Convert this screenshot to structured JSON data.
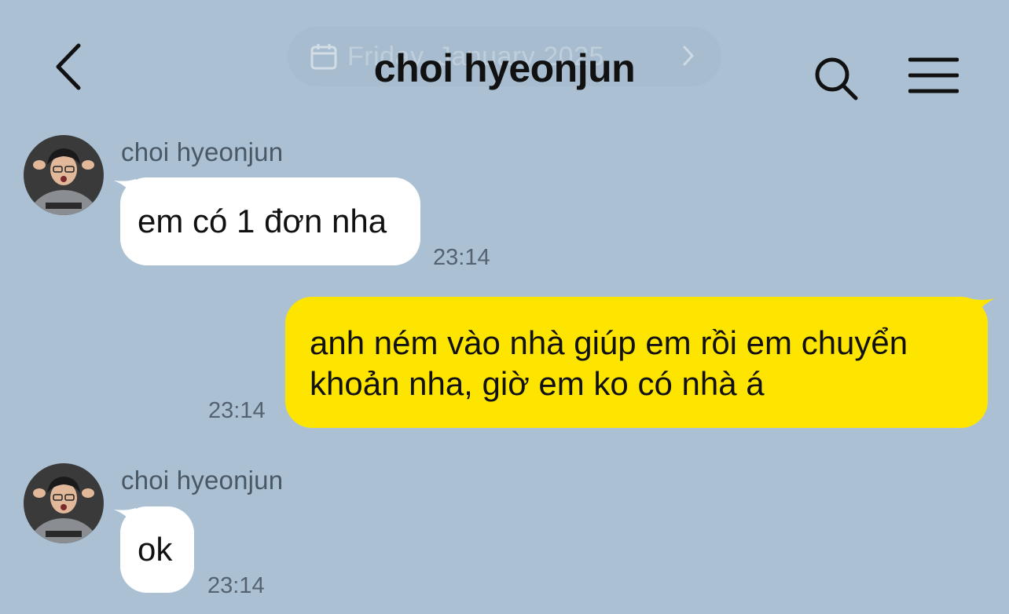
{
  "header": {
    "title": "choi hyeonjun",
    "date_pill": {
      "text": "Friday, January 2025"
    }
  },
  "messages": [
    {
      "direction": "incoming",
      "sender": "choi hyeonjun",
      "text": "em có 1 đơn nha",
      "time": "23:14"
    },
    {
      "direction": "outgoing",
      "line1": "anh ném vào nhà giúp em rồi em chuyển",
      "line2": "khoản nha, giờ em ko có nhà á",
      "time": "23:14"
    },
    {
      "direction": "incoming",
      "sender": "choi hyeonjun",
      "text": "ok",
      "time": "23:14"
    }
  ],
  "colors": {
    "background": "#abc1d3",
    "incoming_bubble": "#ffffff",
    "outgoing_bubble": "#fee500"
  },
  "icons": {
    "back": "chevron-left-icon",
    "search": "search-icon",
    "menu": "hamburger-menu-icon",
    "calendar": "calendar-icon"
  }
}
